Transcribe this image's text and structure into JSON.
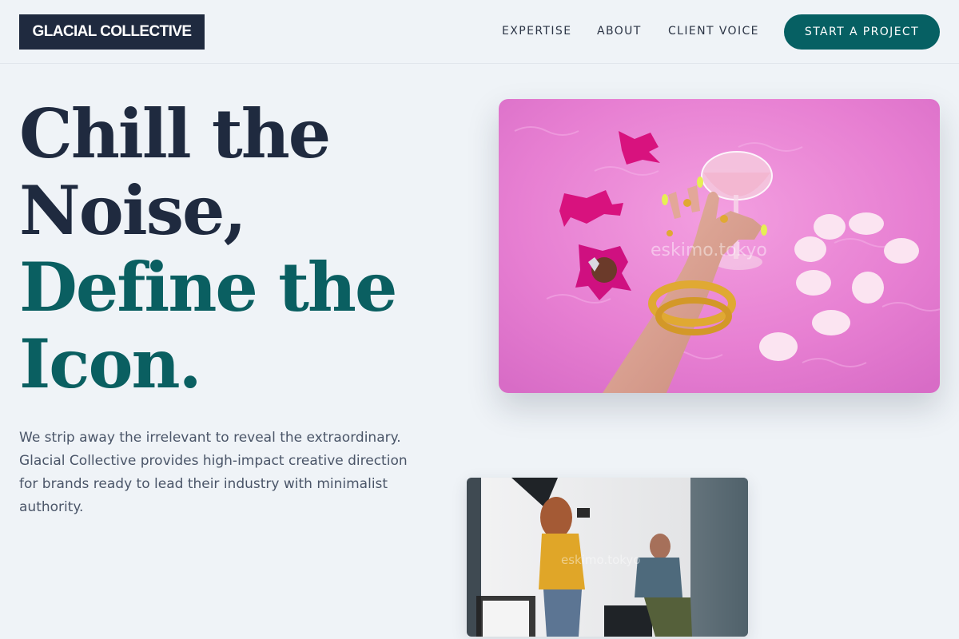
{
  "brand": {
    "name": "GLACIAL COLLECTIVE"
  },
  "nav": {
    "expertise": "EXPERTISE",
    "about": "ABOUT",
    "client_voice": "CLIENT VOICE",
    "cta": "START A PROJECT"
  },
  "hero": {
    "line1": "Chill the",
    "line2": "Noise,",
    "line3": "Define the",
    "line4": "Icon.",
    "description": "We strip away the irrelevant to reveal the extraordinary. Glacial Collective provides high-impact creative direction for brands ready to lead their industry with minimalist authority."
  },
  "images": {
    "main_watermark": "eskimo.tokyo",
    "secondary_watermark": "eskimo.tokyo"
  },
  "colors": {
    "dark": "#1f2a3f",
    "accent": "#066063",
    "background": "#eff3f7",
    "body_text": "#4a5568"
  }
}
